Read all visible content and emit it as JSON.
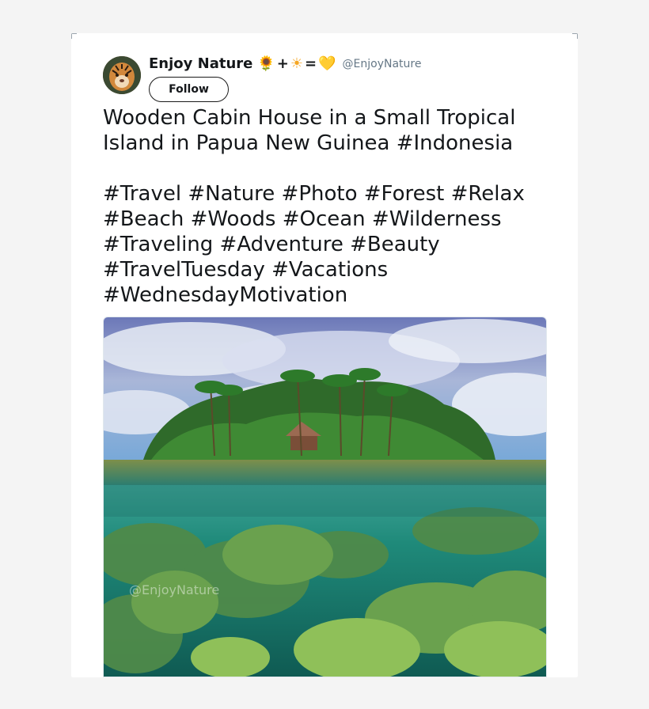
{
  "user": {
    "display_name": "Enjoy Nature",
    "emoji_flower": "🌻",
    "emoji_plus": "+",
    "emoji_sun": "☀",
    "emoji_equals": "=",
    "emoji_heart": "💛",
    "handle": "@EnjoyNature"
  },
  "follow_label": "Follow",
  "tweet": {
    "text": "Wooden Cabin House in a Small Tropical Island in Papua New Guinea #Indonesia\n\n#Travel #Nature #Photo #Forest #Relax #Beach #Woods #Ocean #Wilderness #Traveling #Adventure #Beauty #TravelTuesday #Vacations #WednesdayMotivation"
  },
  "media": {
    "watermark": "@EnjoyNature"
  },
  "icons": {
    "avatar": "tiger-avatar",
    "photo": "tropical-island-photo"
  }
}
